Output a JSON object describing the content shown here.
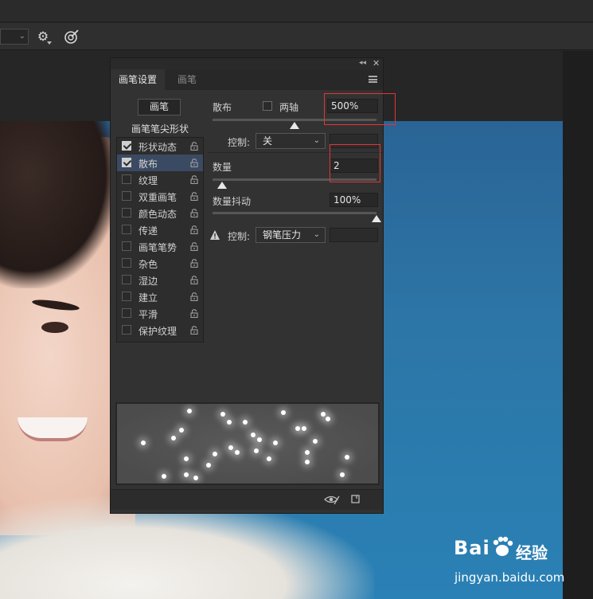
{
  "panel": {
    "tabs": [
      "画笔设置",
      "画笔"
    ],
    "brush_button": "画笔",
    "tip_shape": "画笔笔尖形状",
    "options": [
      {
        "label": "形状动态",
        "checked": true,
        "selected": false
      },
      {
        "label": "散布",
        "checked": true,
        "selected": true
      },
      {
        "label": "纹理",
        "checked": false,
        "selected": false
      },
      {
        "label": "双重画笔",
        "checked": false,
        "selected": false
      },
      {
        "label": "颜色动态",
        "checked": false,
        "selected": false
      },
      {
        "label": "传递",
        "checked": false,
        "selected": false
      },
      {
        "label": "画笔笔势",
        "checked": false,
        "selected": false
      },
      {
        "label": "杂色",
        "checked": false,
        "selected": false
      },
      {
        "label": "湿边",
        "checked": false,
        "selected": false
      },
      {
        "label": "建立",
        "checked": false,
        "selected": false
      },
      {
        "label": "平滑",
        "checked": false,
        "selected": false
      },
      {
        "label": "保护纹理",
        "checked": false,
        "selected": false
      }
    ]
  },
  "scatter": {
    "label": "散布",
    "both_axes_label": "两轴",
    "both_axes_checked": false,
    "value": "500%",
    "slider_fraction": 0.5,
    "control_label": "控制:",
    "control_value": "关"
  },
  "count": {
    "label": "数量",
    "value": "2",
    "slider_fraction": 0.06
  },
  "count_jitter": {
    "label": "数量抖动",
    "value": "100%",
    "slider_fraction": 1.0,
    "control_label": "控制:",
    "control_value": "钢笔压力"
  },
  "watermark": {
    "brand_left": "Bai",
    "brand_right": "经验",
    "url": "jingyan.baidu.com"
  },
  "colors": {
    "panel_bg": "#323232",
    "selection": "#3b4a63",
    "highlight": "#e23636",
    "canvas_blue": "#2a81b5"
  }
}
